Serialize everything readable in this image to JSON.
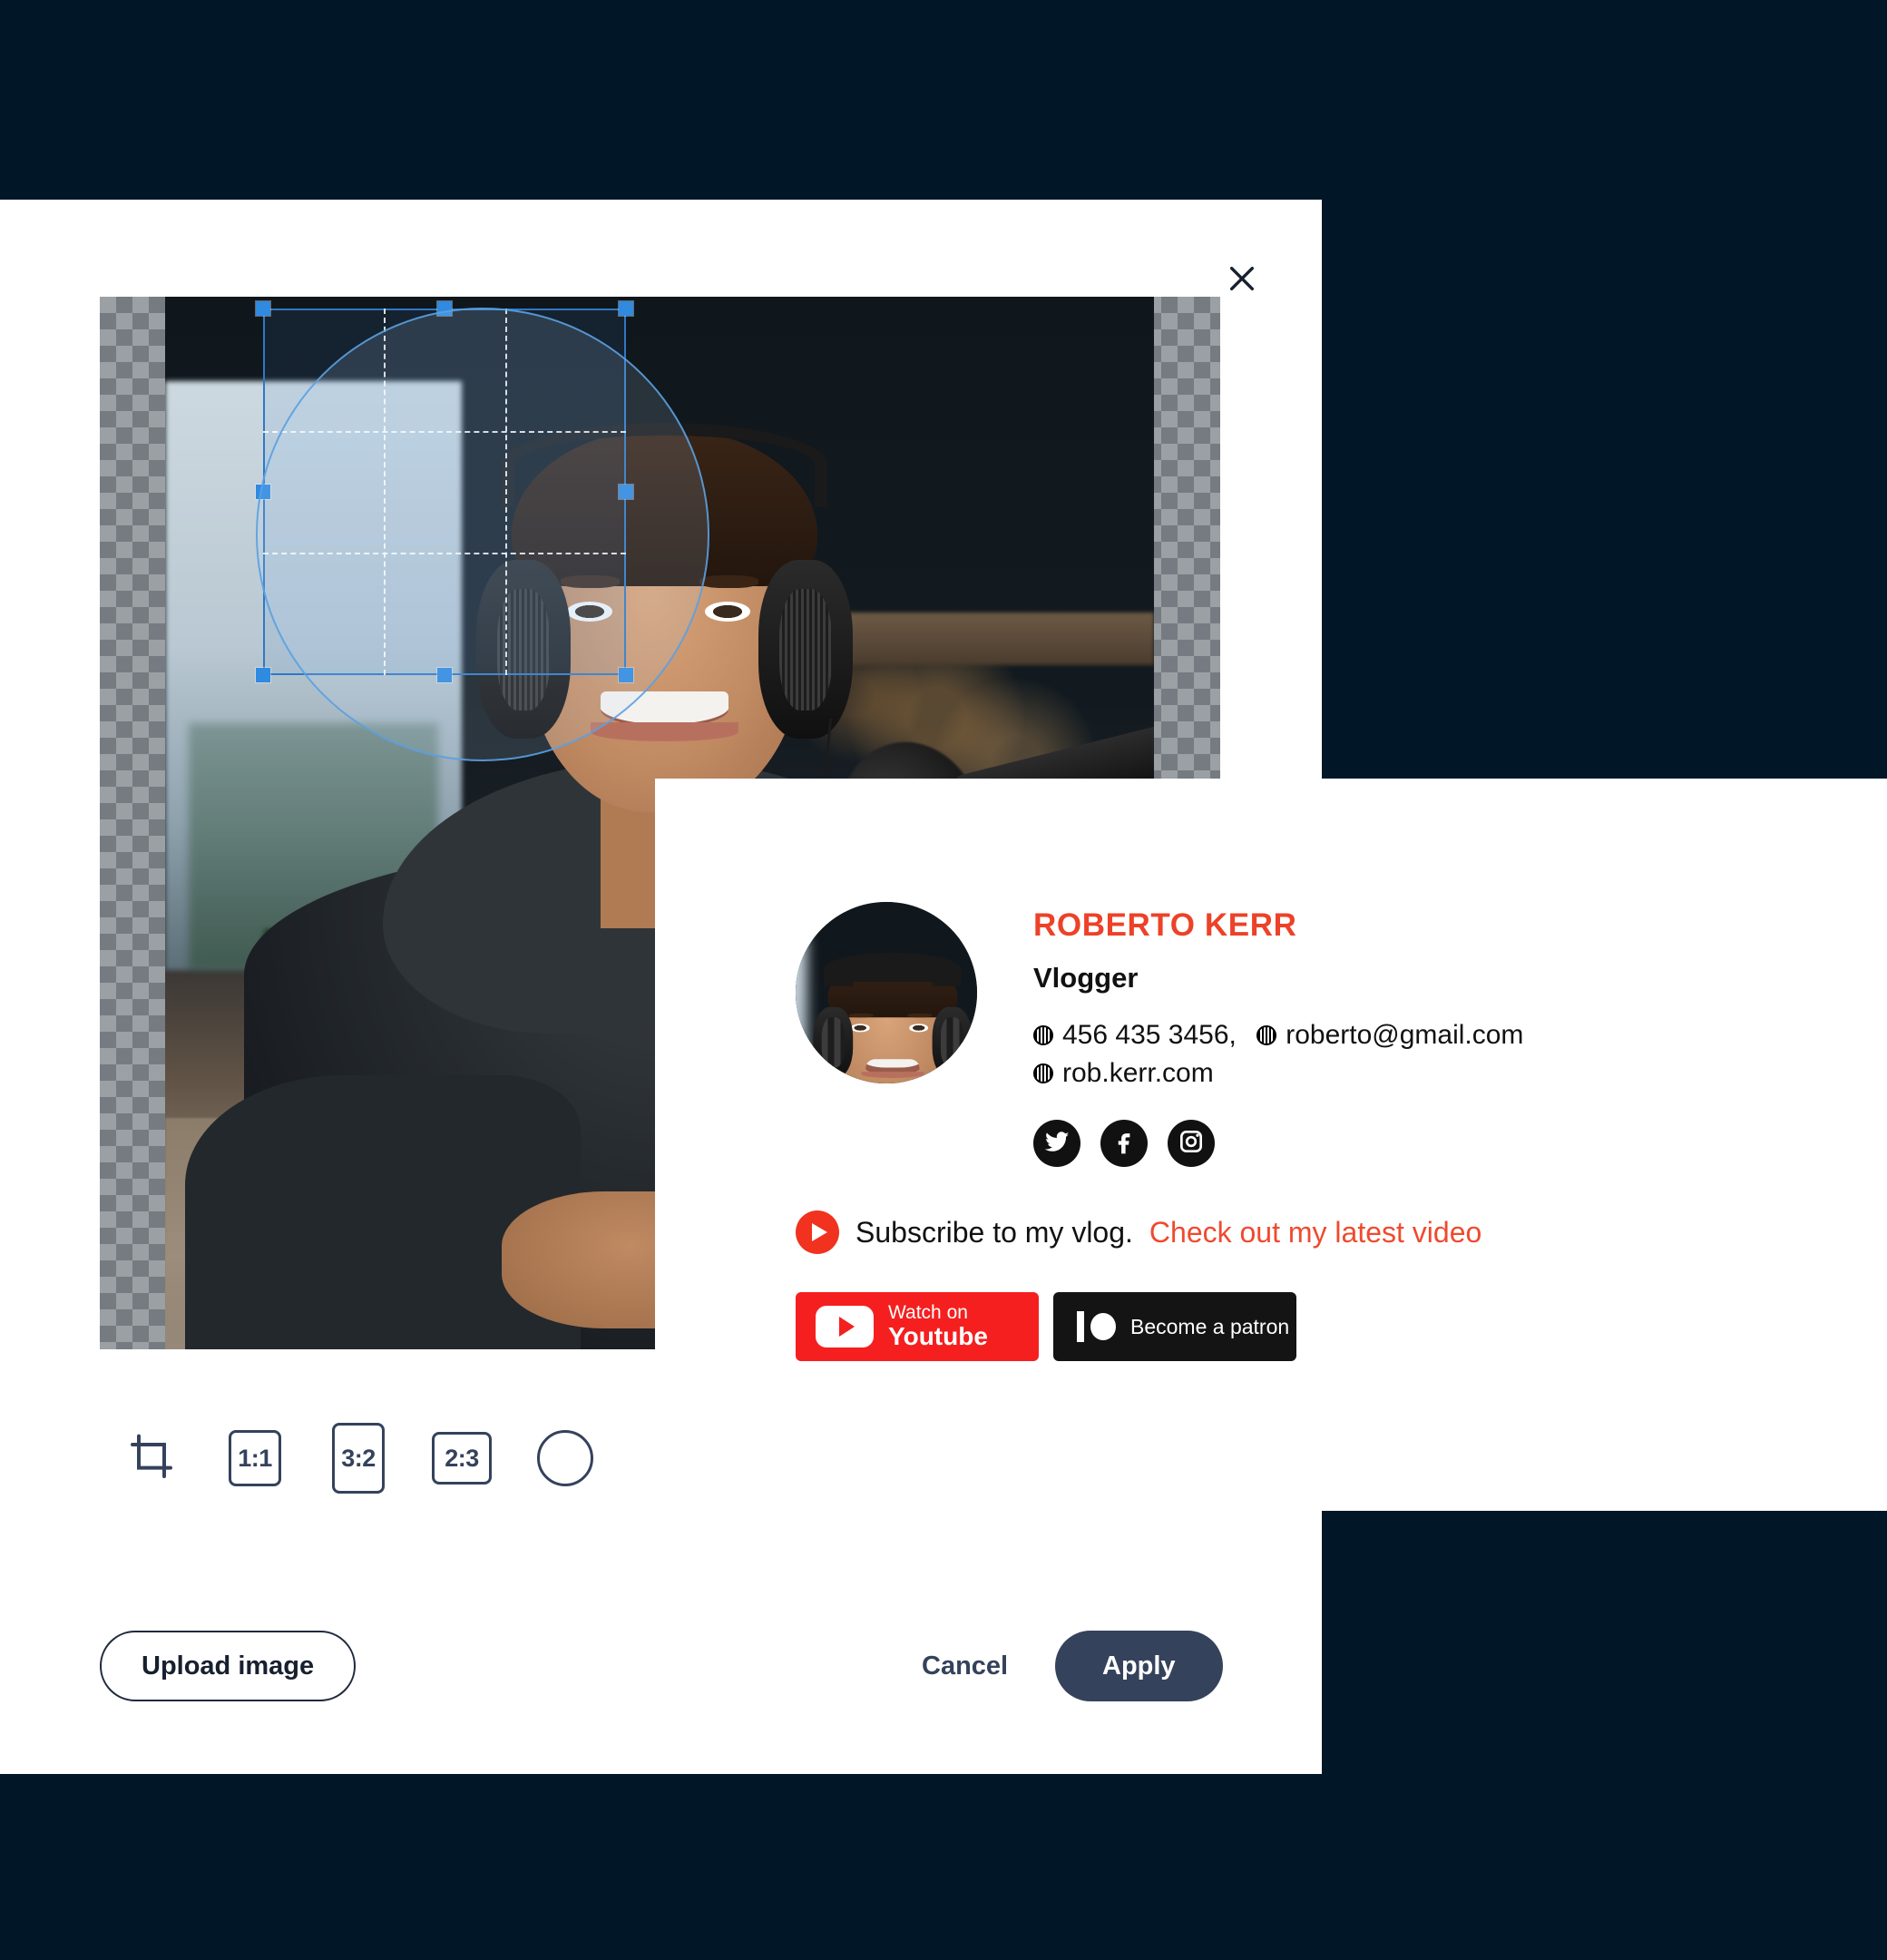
{
  "theme": {
    "page_background": "#011627",
    "accent_navy": "#34425c",
    "accent_red": "#ec4228",
    "crop_handle_blue": "#2f8ae0"
  },
  "crop_modal": {
    "close_icon": "close-icon",
    "canvas": {
      "transparency_checkerboard": true,
      "image_alt": "Young vlogger with headphones smiling at desk in studio"
    },
    "toolbar": {
      "items": [
        {
          "name": "free-crop",
          "icon": "crop-icon",
          "label": ""
        },
        {
          "name": "ratio-1-1",
          "icon": "square-icon",
          "label": "1:1"
        },
        {
          "name": "ratio-3-2",
          "icon": "portrait-icon",
          "label": "3:2"
        },
        {
          "name": "ratio-2-3",
          "icon": "landscape-icon",
          "label": "2:3"
        },
        {
          "name": "circle-crop",
          "icon": "circle-icon",
          "label": ""
        }
      ]
    },
    "footer": {
      "upload_label": "Upload image",
      "cancel_label": "Cancel",
      "apply_label": "Apply"
    }
  },
  "signature_card": {
    "avatar_alt": "Roberto Kerr profile photo",
    "name": "ROBERTO KERR",
    "role": "Vlogger",
    "contacts": [
      {
        "icon": "phone-icon",
        "value": "456 435 3456,"
      },
      {
        "icon": "email-icon",
        "value": "roberto@gmail.com"
      }
    ],
    "website": {
      "icon": "globe-icon",
      "value": "rob.kerr.com"
    },
    "socials": [
      {
        "name": "twitter-icon"
      },
      {
        "name": "facebook-icon"
      },
      {
        "name": "instagram-icon"
      }
    ],
    "subscribe": {
      "play_icon": "youtube-play-icon",
      "text": "Subscribe to my vlog.",
      "link_text": "Check out my latest video"
    },
    "cta": {
      "youtube": {
        "line1": "Watch on",
        "line2": "Youtube"
      },
      "patreon": {
        "label": "Become a patron"
      }
    }
  }
}
